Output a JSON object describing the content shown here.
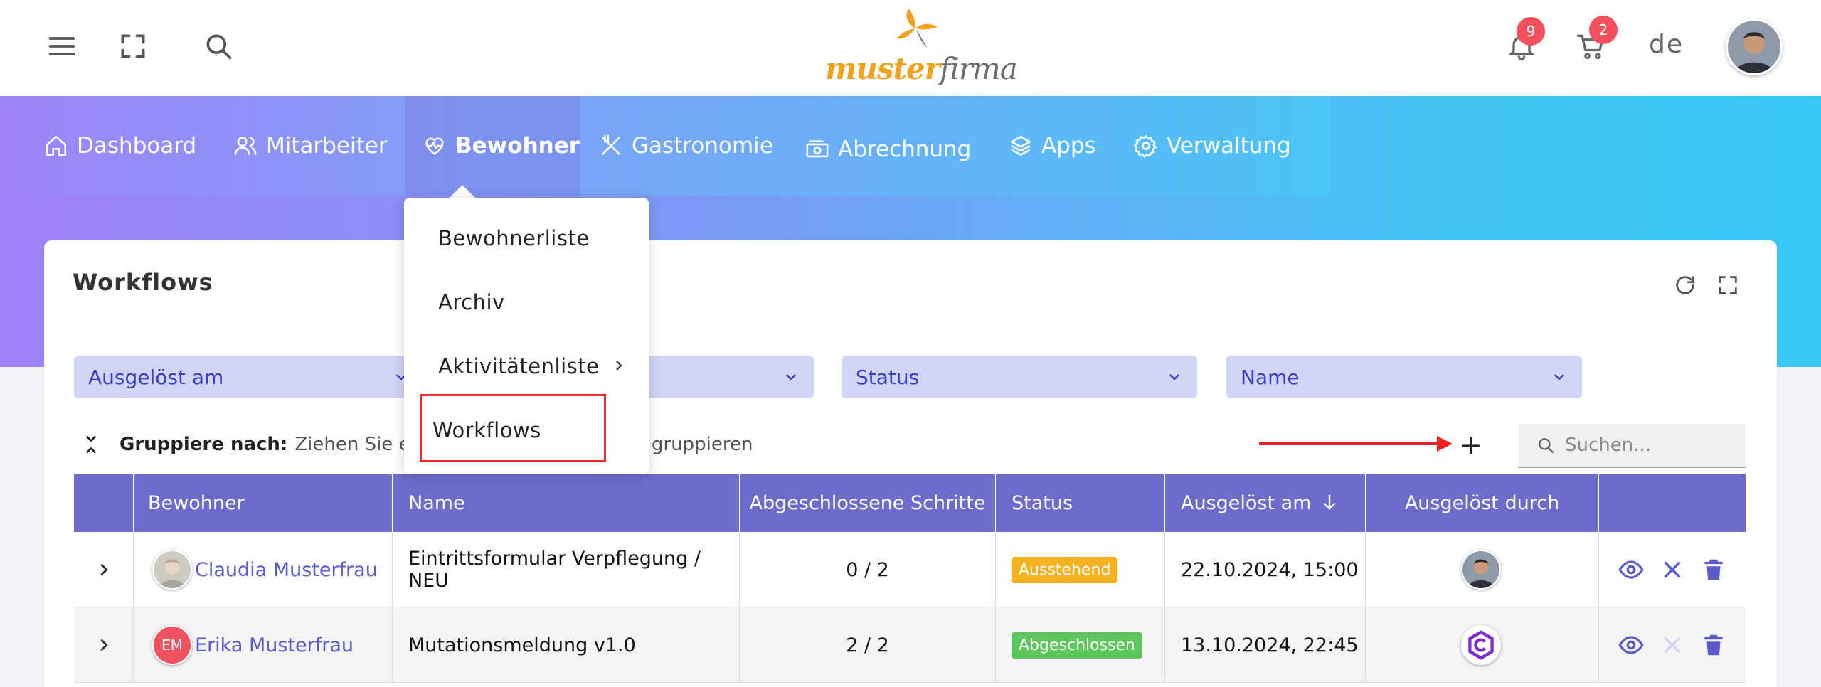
{
  "brand": {
    "part1": "muster",
    "part2": "firma"
  },
  "topbar": {
    "notifications_count": "9",
    "cart_count": "2",
    "language": "de"
  },
  "nav": {
    "items": [
      {
        "label": "Dashboard",
        "icon": "home-icon"
      },
      {
        "label": "Mitarbeiter",
        "icon": "users-icon"
      },
      {
        "label": "Bewohner",
        "icon": "heart-pulse-icon",
        "active": true
      },
      {
        "label": "Gastronomie",
        "icon": "utensils-icon"
      },
      {
        "label": "Abrechnung",
        "icon": "money-icon"
      },
      {
        "label": "Apps",
        "icon": "layers-icon"
      },
      {
        "label": "Verwaltung",
        "icon": "gear-icon"
      }
    ]
  },
  "menu": {
    "items": [
      "Bewohnerliste",
      "Archiv",
      "Aktivitätenliste",
      "Workflows"
    ]
  },
  "card": {
    "title": "Workflows"
  },
  "filters": [
    "Ausgelöst am",
    "",
    "Status",
    "Name"
  ],
  "group": {
    "label": "Gruppiere nach:",
    "hint_left": "Ziehen Sie eine S",
    "hint_right": "gruppieren"
  },
  "search": {
    "placeholder": "Suchen..."
  },
  "table": {
    "headers": [
      "Bewohner",
      "Name",
      "Abgeschlossene Schritte",
      "Status",
      "Ausgelöst am",
      "Ausgelöst durch"
    ],
    "rows": [
      {
        "bewohner": "Claudia Musterfrau",
        "name": "Eintrittsformular Verpflegung / NEU",
        "schritte": "0 / 2",
        "status": "Ausstehend",
        "status_color": "#f5b120",
        "datum": "22.10.2024, 15:00"
      },
      {
        "bewohner": "Erika Musterfrau",
        "initials": "EM",
        "name": "Mutationsmeldung v1.0",
        "schritte": "2 / 2",
        "status": "Abgeschlossen",
        "status_color": "#5cc65c",
        "datum": "13.10.2024, 22:45"
      }
    ]
  },
  "colors": {
    "accent": "#6e6ccb",
    "link": "#5a5ac9",
    "filter_bg": "#d1d5f6",
    "highlight": "#ef2a2a"
  }
}
